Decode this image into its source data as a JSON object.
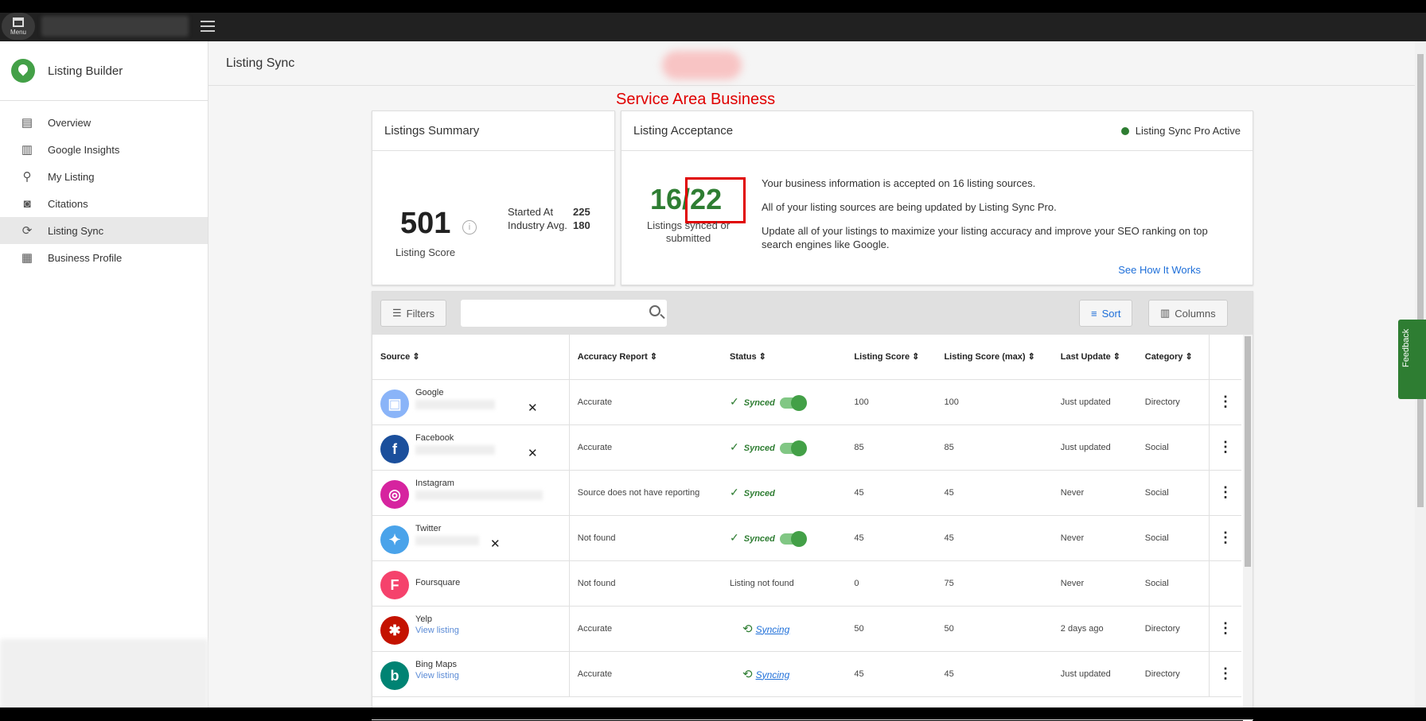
{
  "appbar": {
    "menu_label": "Menu"
  },
  "sidebar": {
    "title": "Listing Builder",
    "items": [
      {
        "label": "Overview",
        "icon": "overview-icon"
      },
      {
        "label": "Google Insights",
        "icon": "bar-chart-icon"
      },
      {
        "label": "My Listing",
        "icon": "location-pin-icon"
      },
      {
        "label": "Citations",
        "icon": "search-box-icon"
      },
      {
        "label": "Listing Sync",
        "icon": "sync-icon",
        "active": true
      },
      {
        "label": "Business Profile",
        "icon": "building-icon"
      }
    ]
  },
  "header": {
    "title": "Listing Sync"
  },
  "annotation": {
    "text": "Service Area Business",
    "color": "#e00000"
  },
  "summary": {
    "title": "Listings Summary",
    "score": "501",
    "score_label": "Listing Score",
    "started_label": "Started At",
    "started_value": "225",
    "industry_label": "Industry Avg.",
    "industry_value": "180"
  },
  "acceptance": {
    "title": "Listing Acceptance",
    "status": "Listing Sync Pro Active",
    "ratio": "16/22",
    "ratio_label": "Listings synced or submitted",
    "line1": "Your business information is accepted on 16 listing sources.",
    "line2": "All of your listing sources are being updated by Listing Sync Pro.",
    "line3": "Update all of your listings to maximize your listing accuracy and improve your SEO ranking on top search engines like Google.",
    "link": "See How It Works"
  },
  "toolbar": {
    "filters": "Filters",
    "sort": "Sort",
    "columns": "Columns"
  },
  "table": {
    "headers": [
      "Source",
      "Accuracy Report",
      "Status",
      "Listing Score",
      "Listing Score (max)",
      "Last Update",
      "Category"
    ],
    "rows": [
      {
        "source": "Google",
        "link": "",
        "accuracy": "Accurate",
        "status": "Synced",
        "score": "100",
        "max": "100",
        "updated": "Just updated",
        "category": "Directory"
      },
      {
        "source": "Facebook",
        "link": "",
        "accuracy": "Accurate",
        "status": "Synced",
        "score": "85",
        "max": "85",
        "updated": "Just updated",
        "category": "Social"
      },
      {
        "source": "Instagram",
        "link": "",
        "accuracy": "Source does not have reporting",
        "status": "Synced",
        "score": "45",
        "max": "45",
        "updated": "Never",
        "category": "Social"
      },
      {
        "source": "Twitter",
        "link": "",
        "accuracy": "Not found",
        "status": "Synced",
        "score": "45",
        "max": "45",
        "updated": "Never",
        "category": "Social"
      },
      {
        "source": "Foursquare",
        "link": "",
        "accuracy": "Not found",
        "status": "Listing not found",
        "score": "0",
        "max": "75",
        "updated": "Never",
        "category": "Social"
      },
      {
        "source": "Yelp",
        "link": "View listing",
        "accuracy": "Accurate",
        "status": "Syncing",
        "score": "50",
        "max": "50",
        "updated": "2 days ago",
        "category": "Directory"
      },
      {
        "source": "Bing Maps",
        "link": "View listing",
        "accuracy": "Accurate",
        "status": "Syncing",
        "score": "45",
        "max": "45",
        "updated": "Just updated",
        "category": "Directory"
      }
    ]
  },
  "feedback": {
    "label": "Feedback"
  }
}
